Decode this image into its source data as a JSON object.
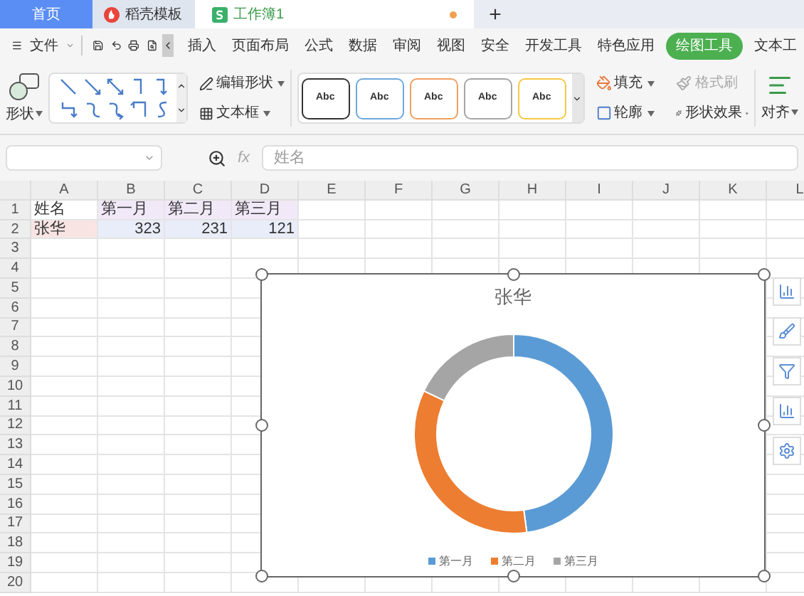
{
  "tabs": [
    {
      "label": "首页",
      "kind": "home",
      "selected": false
    },
    {
      "label": "稻壳模板",
      "kind": "docer",
      "selected": false
    },
    {
      "label": "工作簿1",
      "kind": "sheet",
      "selected": true,
      "unsaved": true
    }
  ],
  "new_tab": "+",
  "menu": {
    "file": "文件",
    "items": [
      {
        "label": "插入",
        "selected": false
      },
      {
        "label": "页面布局",
        "selected": false
      },
      {
        "label": "公式",
        "selected": false
      },
      {
        "label": "数据",
        "selected": false
      },
      {
        "label": "审阅",
        "selected": false
      },
      {
        "label": "视图",
        "selected": false
      },
      {
        "label": "安全",
        "selected": false
      },
      {
        "label": "开发工具",
        "selected": false
      },
      {
        "label": "特色应用",
        "selected": false
      },
      {
        "label": "绘图工具",
        "selected": true
      },
      {
        "label": "文本工",
        "selected": false
      }
    ]
  },
  "ribbon": {
    "shape": "形状",
    "edit_shape": "编辑形状",
    "text_box": "文本框",
    "styles": [
      {
        "label": "Abc",
        "color": "#333333"
      },
      {
        "label": "Abc",
        "color": "#6fa8dc"
      },
      {
        "label": "Abc",
        "color": "#f0a060"
      },
      {
        "label": "Abc",
        "color": "#a5a5a5"
      },
      {
        "label": "Abc",
        "color": "#f6c744"
      }
    ],
    "fill": "填充",
    "format_painter": {
      "label": "格式刷",
      "disabled": true
    },
    "outline": "轮廓",
    "shape_effects": "形状效果",
    "align": "对齐"
  },
  "formula_bar": {
    "fx": "fx",
    "formula": "姓名"
  },
  "sheet": {
    "columns": [
      "A",
      "B",
      "C",
      "D",
      "E",
      "F",
      "G",
      "H",
      "I",
      "J",
      "K",
      "L"
    ],
    "row_headers": [
      "1",
      "2",
      "3",
      "4",
      "5",
      "6",
      "7",
      "8",
      "9",
      "10",
      "11",
      "12",
      "13",
      "14",
      "15",
      "16",
      "17",
      "18",
      "19",
      "20"
    ],
    "cells": [
      [
        {
          "text": "姓名",
          "kind": "plain"
        },
        {
          "text": "第一月",
          "kind": "category"
        },
        {
          "text": "第二月",
          "kind": "category"
        },
        {
          "text": "第三月",
          "kind": "category"
        }
      ],
      [
        {
          "text": "张华",
          "kind": "series"
        },
        {
          "text": "323",
          "kind": "value"
        },
        {
          "text": "231",
          "kind": "value"
        },
        {
          "text": "121",
          "kind": "value"
        }
      ]
    ]
  },
  "chart": {
    "legend": [
      {
        "color": "#5b9bd5"
      },
      {
        "color": "#ed7d31"
      },
      {
        "color": "#a5a5a5"
      }
    ],
    "chart_data": {
      "type": "donut",
      "title": "张华",
      "categories": [
        "第一月",
        "第二月",
        "第三月"
      ],
      "values": [
        47.9,
        34.2,
        17.9
      ]
    }
  }
}
